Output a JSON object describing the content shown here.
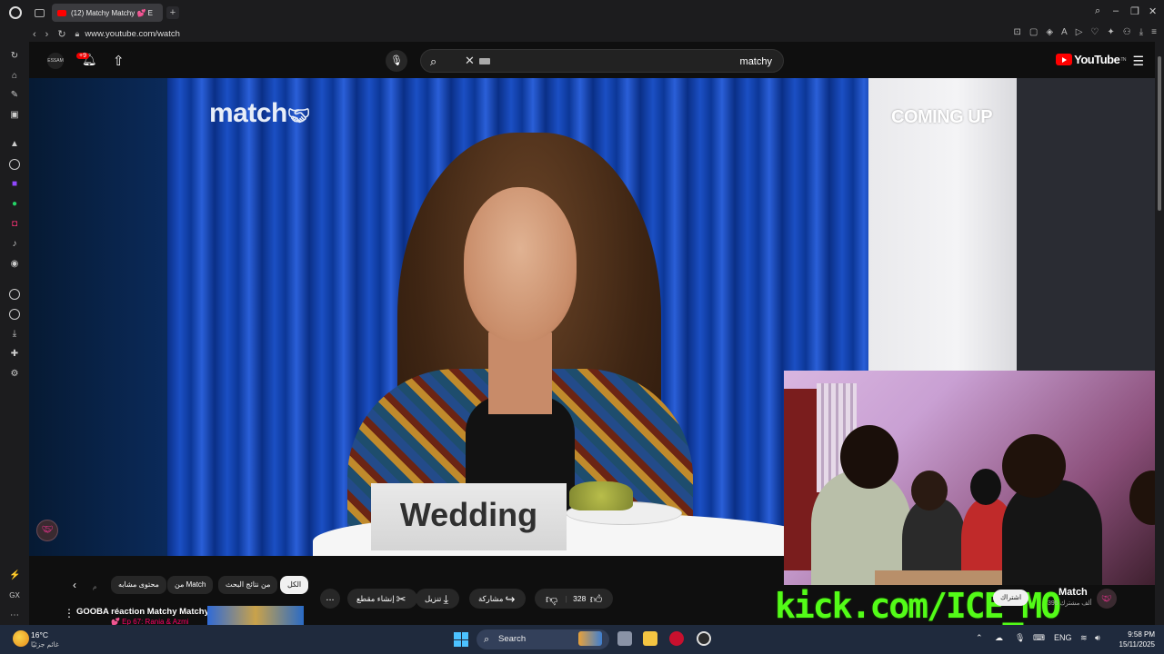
{
  "browser": {
    "tab_title": "(12) Matchy Matchy 💕 E",
    "new_tab": "+",
    "url": "www.youtube.com/watch"
  },
  "youtube": {
    "bell_badge": "+9",
    "search_query": "matchy",
    "logo_text": "YouTube",
    "logo_sup": "TN",
    "avatar_text": "ESSAM"
  },
  "video": {
    "brand_logo": "match",
    "coming_up": "COMING UP",
    "placard": "Wedding"
  },
  "chips": {
    "all": "الكل",
    "from_search": "من نتائج البحث",
    "from_match": "من Match",
    "similar": "محتوى مشابه",
    "faded": "م"
  },
  "actions": {
    "like_count": "328",
    "share": "مشاركة",
    "download": "تنزيل",
    "clip": "إنشاء مقطع",
    "more": "..."
  },
  "recommendation": {
    "title": "GOOBA réaction Matchy Matchy",
    "subtitle": "💕 Ep 67: Rania & Azmi"
  },
  "channel": {
    "name": "Match",
    "subscribers": "395 ألف مشترك",
    "subscribe_button": "اشتراك"
  },
  "stream_overlay": {
    "kick_text": "kick.com/ICE_MO"
  },
  "taskbar": {
    "temperature": "16°C",
    "weather_desc": "غائم جزئيًا",
    "search_label": "Search",
    "language": "ENG",
    "time": "9:58 PM",
    "date": "15/11/2025"
  },
  "colors": {
    "youtube_red": "#ff0000",
    "kick_green": "#53fc18",
    "taskbar": "#1f2a3d"
  }
}
